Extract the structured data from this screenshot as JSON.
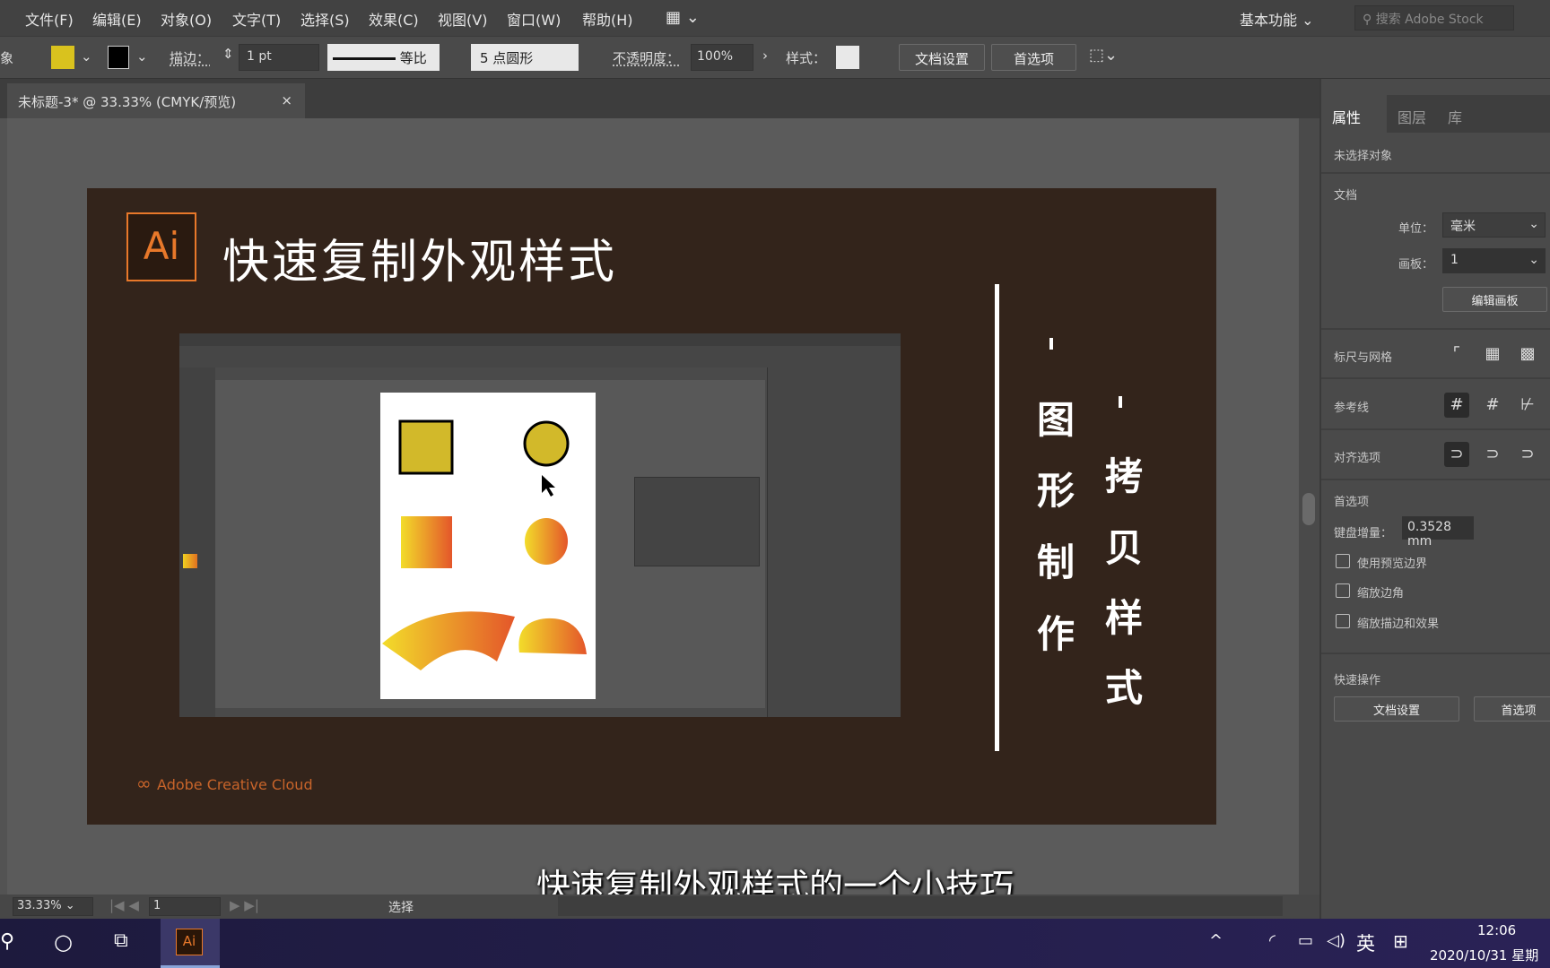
{
  "menu": {
    "items": [
      "文件(F)",
      "编辑(E)",
      "对象(O)",
      "文字(T)",
      "选择(S)",
      "效果(C)",
      "视图(V)",
      "窗口(W)",
      "帮助(H)"
    ],
    "workspace": "基本功能",
    "search_placeholder": "搜索 Adobe Stock"
  },
  "options": {
    "left_fragment": "象",
    "stroke_label": "描边：",
    "stroke_value": "1 pt",
    "stroke_profile": "等比",
    "brush": "5 点圆形",
    "opacity_label": "不透明度：",
    "opacity_value": "100%",
    "style_label": "样式：",
    "doc_setup": "文档设置",
    "preferences": "首选项",
    "fill_color": "#d9c21e"
  },
  "document_tab": {
    "title": "未标题-3* @ 33.33% (CMYK/预览)",
    "close": "×"
  },
  "artwork": {
    "logo": "Ai",
    "title": "快速复制外观样式",
    "col1": [
      "图",
      "形",
      "制",
      "作"
    ],
    "col2": [
      "拷",
      "贝",
      "样",
      "式"
    ],
    "brand": "Adobe Creative Cloud",
    "bg_color": "#33241b",
    "accent": "#e8782a"
  },
  "subtitle": "快速复制外观样式的一个小技巧",
  "status": {
    "zoom": "33.33%",
    "artboard": "1",
    "tool": "选择"
  },
  "panel": {
    "tabs": [
      "属性",
      "图层",
      "库"
    ],
    "no_selection": "未选择对象",
    "doc_section": "文档",
    "unit_label": "单位：",
    "unit_value": "毫米",
    "artboard_label": "画板：",
    "artboard_value": "1",
    "edit_artboards": "编辑画板",
    "rulers_grids": "标尺与网格",
    "guides": "参考线",
    "snap_options": "对齐选项",
    "prefs_section": "首选项",
    "keyboard_inc_label": "键盘增量：",
    "keyboard_inc_value": "0.3528 mm",
    "checkboxes": [
      "使用预览边界",
      "缩放边角",
      "缩放描边和效果"
    ],
    "quick_actions": "快速操作",
    "qa_doc_setup": "文档设置",
    "qa_prefs": "首选项"
  },
  "taskbar": {
    "app": "Ai",
    "ime": "英",
    "time": "12:06",
    "date": "2020/10/31 星期"
  }
}
